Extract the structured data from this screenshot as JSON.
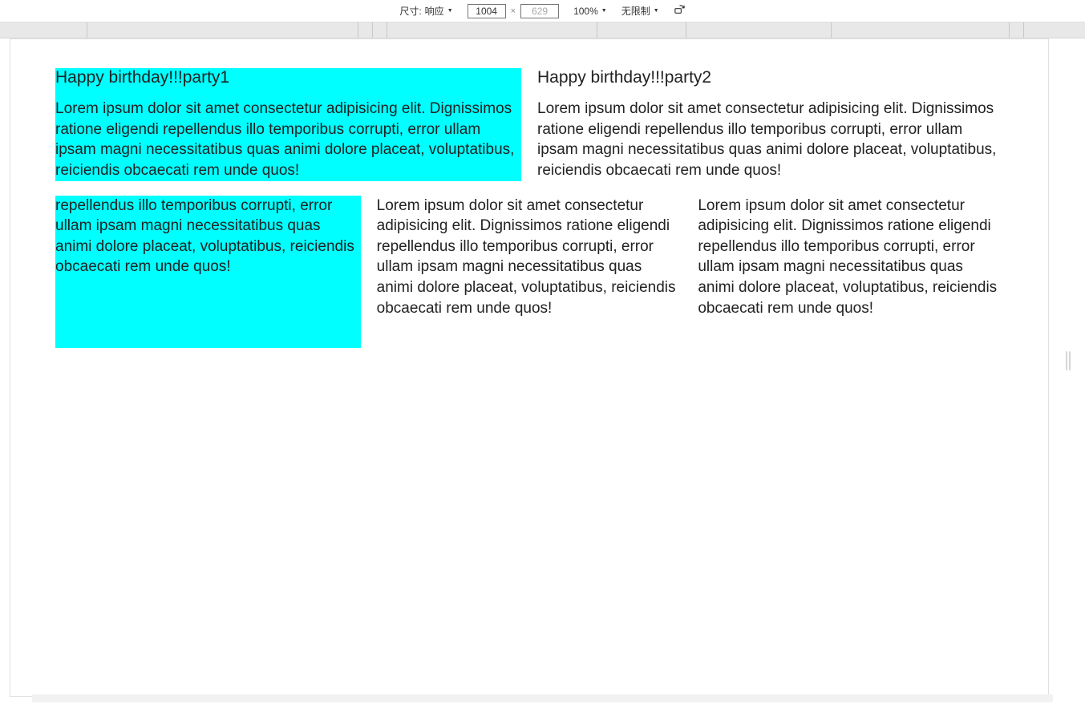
{
  "toolbar": {
    "size_label": "尺寸:",
    "size_value": "响应",
    "width": "1004",
    "height_placeholder": "629",
    "zoom": "100%",
    "throttle": "无限制"
  },
  "content": {
    "row1": {
      "col1": {
        "heading": "Happy birthday!!!party1",
        "text": "Lorem ipsum dolor sit amet consectetur adipisicing elit. Dignissimos ratione eligendi repellendus illo temporibus corrupti, error ullam ipsam magni necessitatibus quas animi dolore placeat, voluptatibus, reiciendis obcaecati rem unde quos!"
      },
      "col2": {
        "heading": "Happy birthday!!!party2",
        "text": "Lorem ipsum dolor sit amet consectetur adipisicing elit. Dignissimos ratione eligendi repellendus illo temporibus corrupti, error ullam ipsam magni necessitatibus quas animi dolore placeat, voluptatibus, reiciendis obcaecati rem unde quos!"
      }
    },
    "row2": {
      "col1": "repellendus illo temporibus corrupti, error ullam ipsam magni necessitatibus quas animi dolore placeat, voluptatibus, reiciendis obcaecati rem unde quos!",
      "col2": "Lorem ipsum dolor sit amet consectetur adipisicing elit. Dignissimos ratione eligendi repellendus illo temporibus corrupti, error ullam ipsam magni necessitatibus quas animi dolore placeat, voluptatibus, reiciendis obcaecati rem unde quos!",
      "col3": "Lorem ipsum dolor sit amet consectetur adipisicing elit. Dignissimos ratione eligendi repellendus illo temporibus corrupti, error ullam ipsam magni necessitatibus quas animi dolore placeat, voluptatibus, reiciendis obcaecati rem unde quos!"
    }
  }
}
